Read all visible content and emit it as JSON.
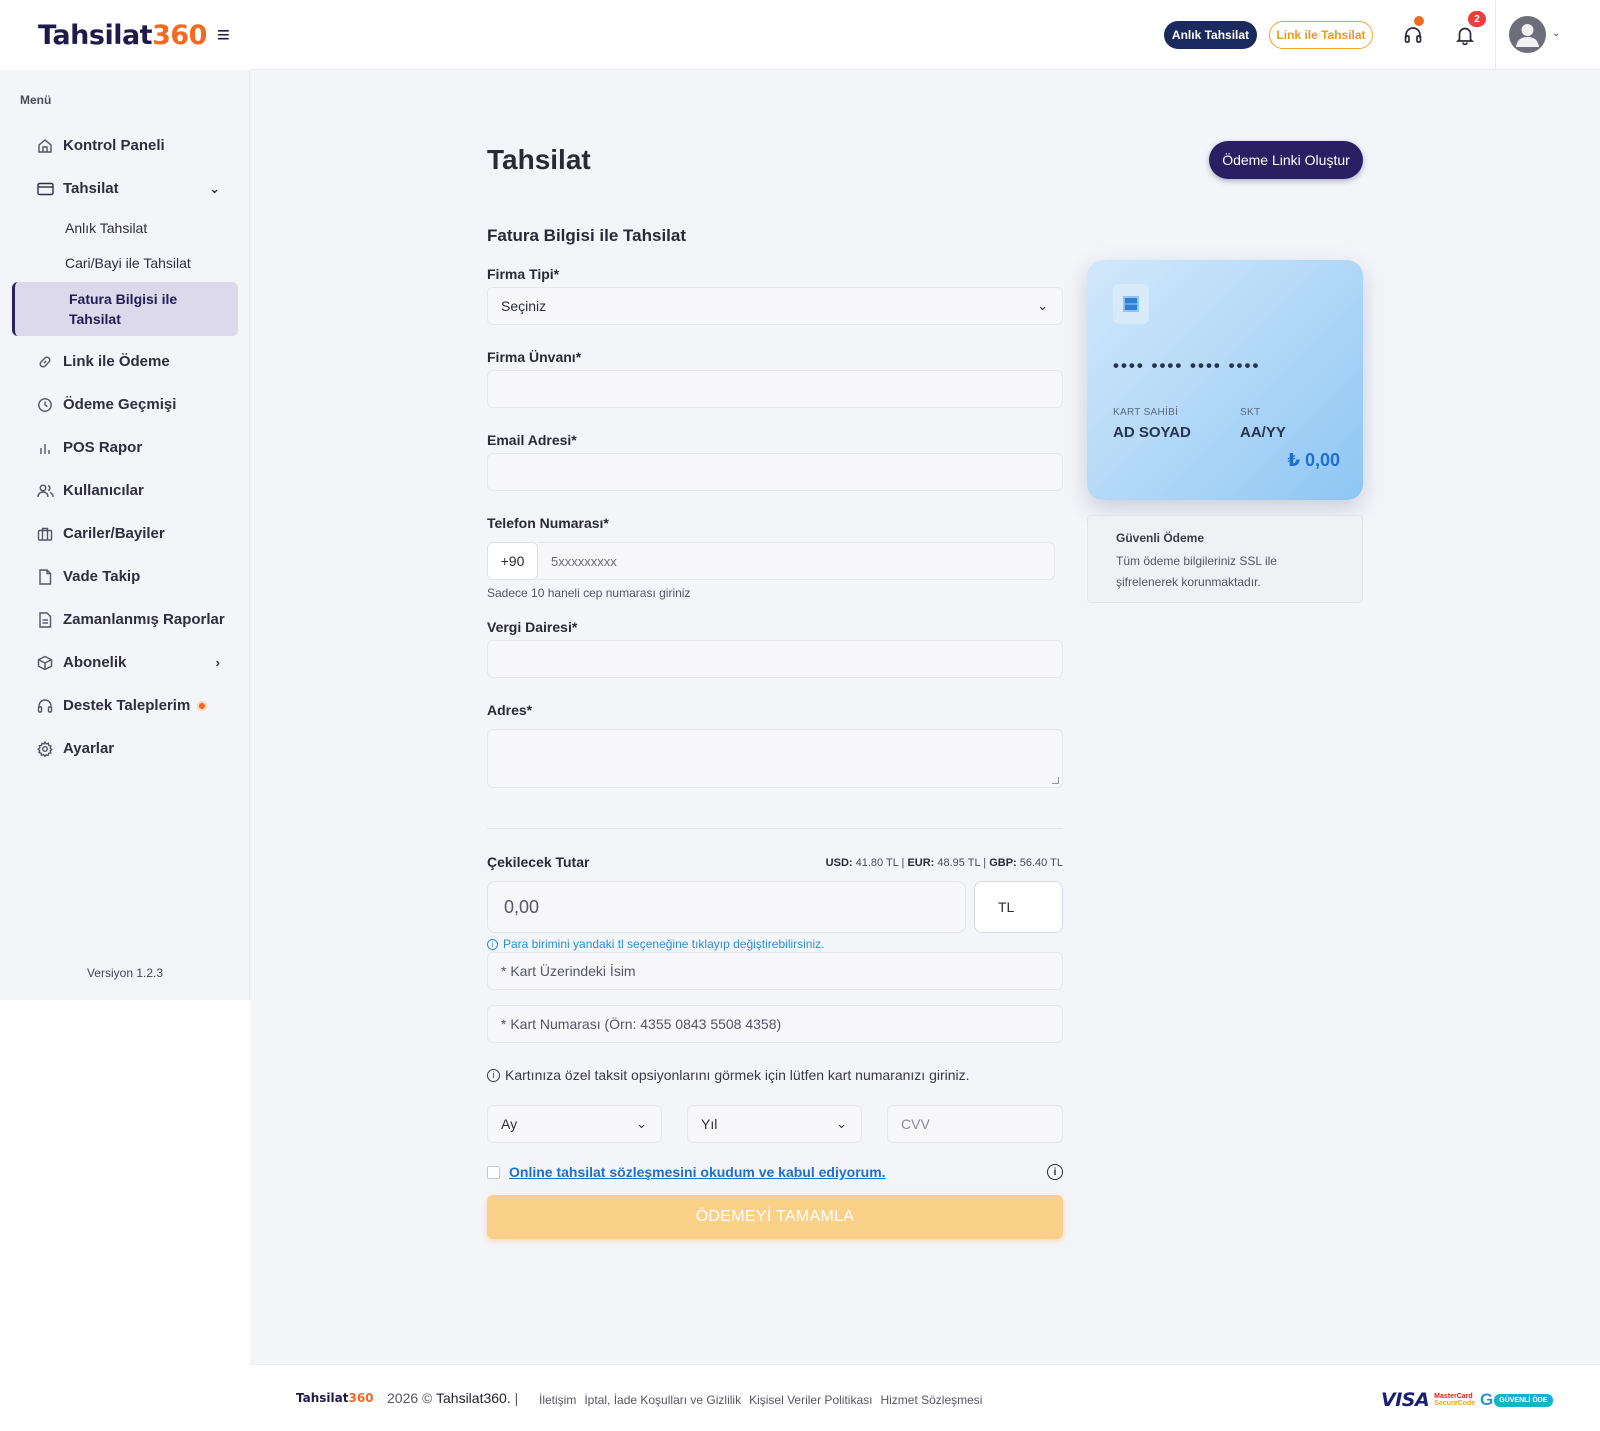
{
  "brand": {
    "logo_text": "Tahsilat",
    "logo_num": "360"
  },
  "sidebar": {
    "menu_label": "Menü",
    "items": [
      {
        "label": "Kontrol Paneli",
        "icon": "home-icon"
      },
      {
        "label": "Tahsilat",
        "icon": "card-icon"
      },
      {
        "label": "Link ile Ödeme",
        "icon": "link-icon"
      },
      {
        "label": "Ödeme Geçmişi",
        "icon": "clock-icon"
      },
      {
        "label": "POS Rapor",
        "icon": "bar-chart-icon"
      },
      {
        "label": "Kullanıcılar",
        "icon": "users-icon"
      },
      {
        "label": "Cariler/Bayiler",
        "icon": "briefcase-icon"
      },
      {
        "label": "Vade Takip",
        "icon": "file-icon"
      },
      {
        "label": "Zamanlanmış Raporlar",
        "icon": "report-icon"
      },
      {
        "label": "Abonelik",
        "icon": "box-icon"
      },
      {
        "label": "Destek Taleplerim",
        "icon": "headset-icon"
      },
      {
        "label": "Ayarlar",
        "icon": "gear-icon"
      }
    ],
    "sub_items": [
      "Anlık Tahsilat",
      "Cari/Bayi ile Tahsilat"
    ],
    "active_sub_line1": "Fatura Bilgisi ile",
    "active_sub_line2": "Tahsilat",
    "version": "Versiyon 1.2.3"
  },
  "topbar": {
    "instant_btn": "Anlık Tahsilat",
    "link_btn": "Link ile Tahsilat",
    "notification_count": "2"
  },
  "page": {
    "title": "Tahsilat",
    "create_link_btn": "Ödeme Linki Oluştur",
    "section_title": "Fatura Bilgisi ile Tahsilat"
  },
  "form": {
    "company_type_label": "Firma Tipi*",
    "company_type_value": "Seçiniz",
    "company_name_label": "Firma Ünvanı*",
    "email_label": "Email Adresi*",
    "phone_label": "Telefon Numarası*",
    "phone_prefix": "+90",
    "phone_placeholder": "5xxxxxxxxx",
    "phone_hint": "Sadece 10 haneli cep numarası giriniz",
    "tax_office_label": "Vergi Dairesi*",
    "address_label": "Adres*",
    "amount_label": "Çekilecek Tutar",
    "rates": {
      "usd_label": "USD:",
      "usd": "41.80 TL",
      "eur_label": "EUR:",
      "eur": "48.95 TL",
      "gbp_label": "GBP:",
      "gbp": "56.40 TL",
      "sep": "|"
    },
    "amount_placeholder": "0,00",
    "currency": "TL",
    "currency_hint": "Para birimini yandaki tl seçeneğine tıklayıp değiştirebilirsiniz.",
    "card_name_placeholder": "* Kart Üzerindeki İsim",
    "card_number_placeholder": "* Kart Numarası (Örn: 4355 0843 5508 4358)",
    "installment_hint": "Kartınıza özel taksit opsiyonlarını görmek için lütfen kart numaranızı giriniz.",
    "month_value": "Ay",
    "year_value": "Yıl",
    "cvv_placeholder": "CVV",
    "agreement_text": "Online tahsilat sözleşmesini okudum ve kabul ediyorum.",
    "submit_label": "ÖDEMEYİ TAMAMLA"
  },
  "card_preview": {
    "number_mask": "•••• •••• •••• ••••",
    "holder_label": "KART SAHİBİ",
    "holder_value": "AD SOYAD",
    "expiry_label": "SKT",
    "expiry_value": "AA/YY",
    "amount": "₺ 0,00"
  },
  "secure": {
    "title": "Güvenli Ödeme",
    "text_line1": "Tüm ödeme bilgileriniz SSL ile",
    "text_line2": "şifrelenerek korunmaktadır."
  },
  "footer": {
    "year": "2026 ©",
    "brand": "Tahsilat360.",
    "separator": "|",
    "links": [
      "İletişim",
      "İptal, İade Koşulları ve Gizlilik",
      "Kişisel Veriler Politikası",
      "Hizmet Sözleşmesi"
    ],
    "visa": "VISA",
    "mastercard_line1": "MasterCard",
    "mastercard_line2": "SecureCode",
    "secure_badge": "GÜVENLİ ÖDE"
  }
}
